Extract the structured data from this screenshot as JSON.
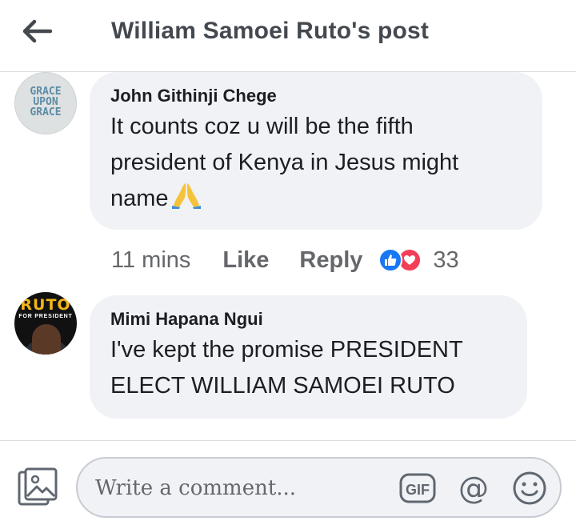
{
  "header": {
    "title": "William Samoei Ruto's post",
    "back_icon": "arrow-left-icon"
  },
  "comments": [
    {
      "author": "John Githinji Chege",
      "avatar_text": [
        "GRACE",
        "UPON",
        "GRACE"
      ],
      "text_lines": [
        "It counts coz u will be the fifth",
        "president of Kenya in Jesus might",
        "name"
      ],
      "emoji": "folded-hands-icon",
      "time": "11 mins",
      "like_label": "Like",
      "reply_label": "Reply",
      "reaction_count": "33",
      "reactions": [
        "like-reaction-icon",
        "love-reaction-icon"
      ]
    },
    {
      "author": "Mimi Hapana Ngui",
      "avatar_text": [
        "RUTO",
        "FOR PRESIDENT"
      ],
      "text_lines": [
        "I've kept the promise PRESIDENT",
        "ELECT WILLIAM SAMOEI RUTO"
      ]
    }
  ],
  "composer": {
    "placeholder": "Write a comment...",
    "icons": [
      "photo-icon",
      "gif-icon",
      "at-mention-icon",
      "emoji-smile-icon"
    ],
    "gif_label": "GIF",
    "at_label": "@"
  },
  "colors": {
    "bubble_bg": "#f0f2f5",
    "meta_text": "#65676b",
    "like_blue": "#1877f2",
    "love_red": "#f33e58"
  }
}
